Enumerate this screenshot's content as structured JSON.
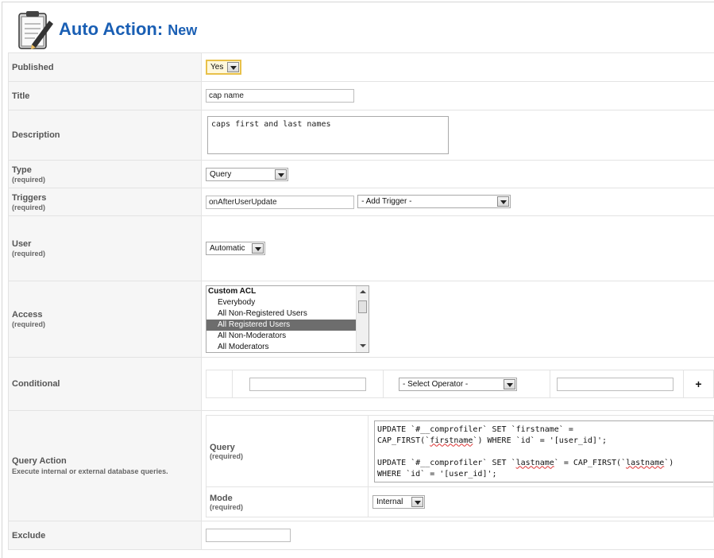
{
  "header": {
    "title_main": "Auto Action:",
    "title_sub": "New",
    "icon": "clipboard-pencil-icon"
  },
  "form": {
    "published": {
      "label": "Published",
      "value": "Yes"
    },
    "title": {
      "label": "Title",
      "value": "cap name"
    },
    "description": {
      "label": "Description",
      "value": "caps first and last names"
    },
    "type": {
      "label": "Type",
      "required": "(required)",
      "value": "Query"
    },
    "triggers": {
      "label": "Triggers",
      "required": "(required)",
      "value": "onAfterUserUpdate",
      "add_trigger": "- Add Trigger -"
    },
    "user": {
      "label": "User",
      "required": "(required)",
      "value": "Automatic"
    },
    "access": {
      "label": "Access",
      "required": "(required)",
      "group": "Custom ACL",
      "options": [
        "Everybody",
        "All Non-Registered Users",
        "All Registered Users",
        "All Non-Moderators",
        "All Moderators"
      ],
      "selected": "All Registered Users"
    },
    "conditional": {
      "label": "Conditional",
      "operator": "- Select Operator -",
      "add": "+"
    },
    "query_action": {
      "label": "Query Action",
      "description": "Execute internal or external database queries.",
      "query_label": "Query",
      "query_required": "(required)",
      "query_line1": "UPDATE `#__comprofiler` SET `firstname` =",
      "query_line2a": "CAP_FIRST(`",
      "query_line2b": "firstname",
      "query_line2c": "`) WHERE `id` = '[user_id]';",
      "query_line4a": "UPDATE `#__comprofiler` SET `",
      "query_line4b": "lastname",
      "query_line4c": "` = CAP_FIRST(`",
      "query_line4d": "lastname",
      "query_line4e": "`)",
      "query_line5": "WHERE `id` = '[user_id]';",
      "mode_label": "Mode",
      "mode_required": "(required)",
      "mode_value": "Internal"
    },
    "exclude": {
      "label": "Exclude",
      "value": ""
    }
  }
}
